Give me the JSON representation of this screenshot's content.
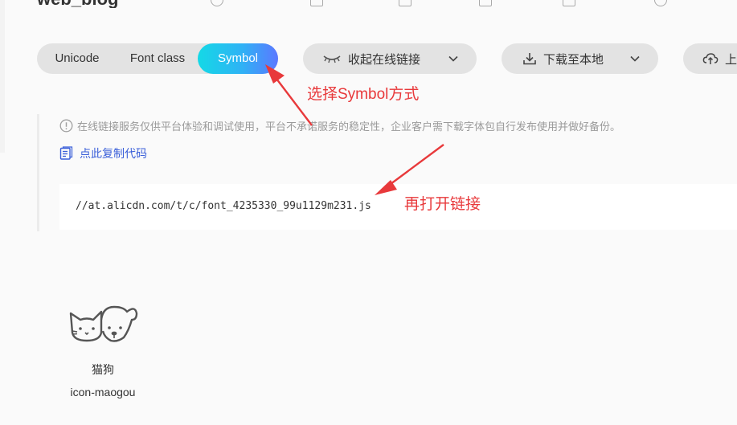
{
  "page": {
    "title_partial": "web_blog"
  },
  "segment": {
    "items": [
      {
        "label": "Unicode",
        "active": false
      },
      {
        "label": "Font class",
        "active": false
      },
      {
        "label": "Symbol",
        "active": true
      }
    ],
    "active_gradient": [
      "#14d9e6",
      "#5b78ff"
    ]
  },
  "toolbar": {
    "collapse_label": "收起在线链接",
    "download_label": "下载至本地",
    "upload_label": "上"
  },
  "notice": {
    "text": "在线链接服务仅供平台体验和调试使用，平台不承诺服务的稳定性，企业客户需下载字体包自行发布使用并做好备份。",
    "copy_label": "点此复制代码",
    "link_color": "#3a5fd9"
  },
  "code": {
    "url": "//at.alicdn.com/t/c/font_4235330_99u1129m231.js"
  },
  "annotations": {
    "step1": "选择Symbol方式",
    "step2": "再打开链接",
    "color": "#e8393b"
  },
  "icons": [
    {
      "name": "猫狗",
      "class_name": "icon-maogou",
      "glyph": "cat-dog-icon"
    }
  ]
}
